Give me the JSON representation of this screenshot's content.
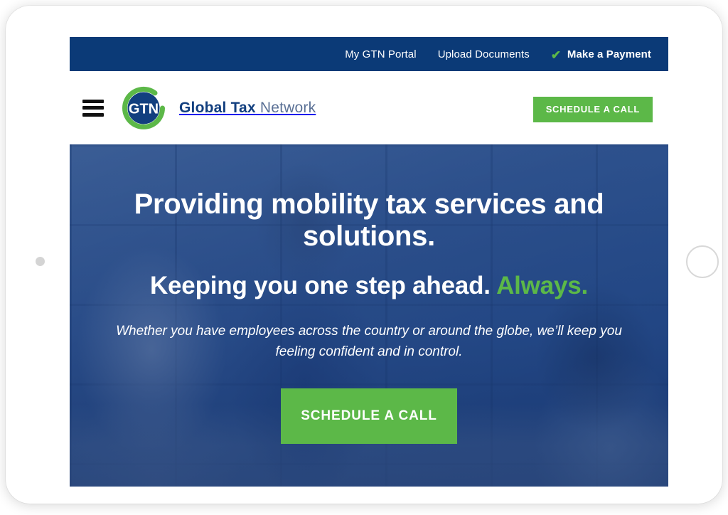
{
  "device": {
    "type": "tablet-landscape",
    "camera_icon": "camera-dot",
    "home_button_icon": "home-button-circle"
  },
  "utility_bar": {
    "background_color": "#0b3a77",
    "links": [
      {
        "label": "My GTN Portal",
        "bold": false
      },
      {
        "label": "Upload Documents",
        "bold": false
      }
    ],
    "payment": {
      "label": "Make a Payment",
      "icon": "check-icon",
      "icon_glyph": "✔",
      "icon_color": "#5cb848"
    }
  },
  "header": {
    "menu_icon": "hamburger-icon",
    "logo": {
      "mark_text": "GTN",
      "ring_color": "#5cb848",
      "disc_color": "#123f7f",
      "brand_bold": "Global Tax",
      "brand_light": "Network"
    },
    "cta": {
      "label": "SCHEDULE A CALL",
      "color": "#5cb848"
    }
  },
  "hero": {
    "headline": "Providing mobility tax services and solutions.",
    "subheadline_main": "Keeping you one step ahead. ",
    "subheadline_accent": "Always.",
    "accent_color": "#5cb848",
    "body": "Whether you have employees across the country or around the globe, we’ll keep you feeling confident and in control.",
    "cta": {
      "label": "SCHEDULE A CALL",
      "color": "#5cb848"
    },
    "overlay_color": "#163a78"
  }
}
